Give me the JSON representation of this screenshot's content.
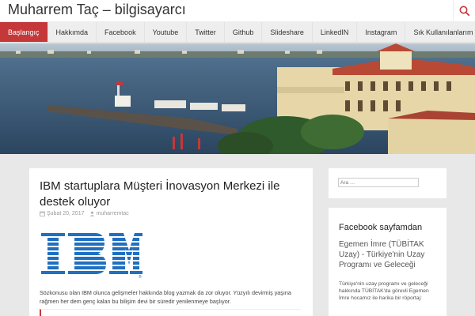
{
  "site": {
    "title": "Muharrem Taç – bilgisayarcı"
  },
  "nav": {
    "items": [
      {
        "label": "Başlangıç",
        "active": true
      },
      {
        "label": "Hakkımda"
      },
      {
        "label": "Facebook"
      },
      {
        "label": "Youtube"
      },
      {
        "label": "Twitter"
      },
      {
        "label": "Github"
      },
      {
        "label": "Slideshare"
      },
      {
        "label": "LinkedIN"
      },
      {
        "label": "Instagram"
      },
      {
        "label": "Sık Kullanılanlarım"
      }
    ]
  },
  "post": {
    "title": "IBM startuplara Müşteri İnovasyon Merkezi ile destek oluyor",
    "date": "Şubat 20, 2017",
    "author": "muharremtac",
    "logo_text": "IBM",
    "excerpt": "Sözkonusu olan IBM olunca gelişmeler hakkında blog yazmak da zor oluyor. Yüzyılı devirmiş yaşına rağmen her dem genç kalan bu bilişim devi bir süredir yenilenmeye başlıyor."
  },
  "sidebar": {
    "search_placeholder": "Ara …",
    "facebook": {
      "heading": "Facebook sayfamdan",
      "title": "Egemen İmre (TÜBİTAK Uzay) - Türkiye'nin Uzay Programı ve Geleceği",
      "text": "Türkiye'nin uzay programı ve geleceği hakkında TÜBİTAK'da görevli Egemen İmre hocamız ile harika bir röportaj:"
    }
  },
  "colors": {
    "accent": "#c5383a",
    "background": "#e8e8e8",
    "ibm_blue": "#1f70c1"
  },
  "icons": {
    "search": "search-icon",
    "calendar": "calendar-icon",
    "user": "user-icon"
  }
}
